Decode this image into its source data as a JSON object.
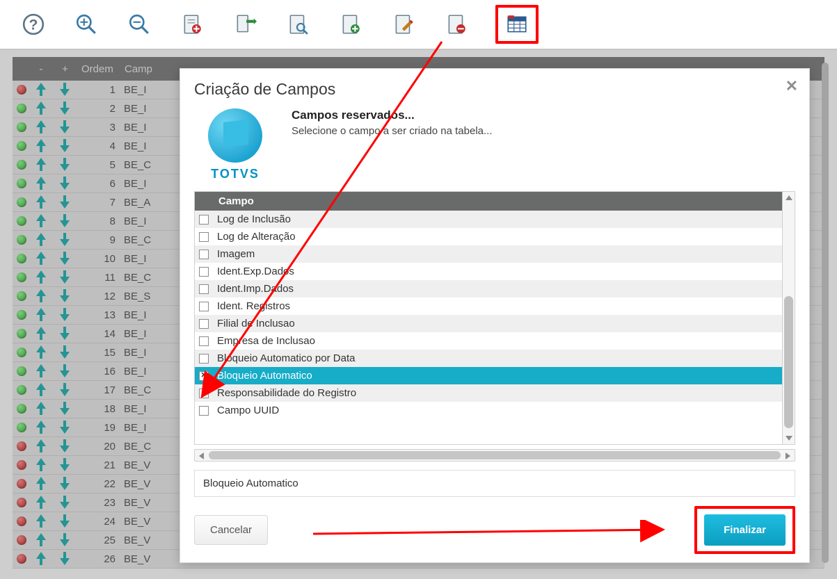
{
  "toolbar": {
    "icons": [
      "help",
      "zoom-in",
      "zoom-out",
      "doc-add",
      "doc-export",
      "doc-search",
      "doc-new",
      "doc-edit",
      "doc-delete",
      "table-grid"
    ]
  },
  "grid": {
    "head": {
      "minus": "-",
      "plus": "+",
      "ordem": "Ordem",
      "campo": "Camp"
    },
    "rows": [
      {
        "dot": "red",
        "ord": 1,
        "camp": "BE_I"
      },
      {
        "dot": "green",
        "ord": 2,
        "camp": "BE_I"
      },
      {
        "dot": "green",
        "ord": 3,
        "camp": "BE_I"
      },
      {
        "dot": "green",
        "ord": 4,
        "camp": "BE_I"
      },
      {
        "dot": "green",
        "ord": 5,
        "camp": "BE_C"
      },
      {
        "dot": "green",
        "ord": 6,
        "camp": "BE_I"
      },
      {
        "dot": "green",
        "ord": 7,
        "camp": "BE_A"
      },
      {
        "dot": "green",
        "ord": 8,
        "camp": "BE_I"
      },
      {
        "dot": "green",
        "ord": 9,
        "camp": "BE_C"
      },
      {
        "dot": "green",
        "ord": 10,
        "camp": "BE_I"
      },
      {
        "dot": "green",
        "ord": 11,
        "camp": "BE_C"
      },
      {
        "dot": "green",
        "ord": 12,
        "camp": "BE_S"
      },
      {
        "dot": "green",
        "ord": 13,
        "camp": "BE_I"
      },
      {
        "dot": "green",
        "ord": 14,
        "camp": "BE_I"
      },
      {
        "dot": "green",
        "ord": 15,
        "camp": "BE_I"
      },
      {
        "dot": "green",
        "ord": 16,
        "camp": "BE_I"
      },
      {
        "dot": "green",
        "ord": 17,
        "camp": "BE_C"
      },
      {
        "dot": "green",
        "ord": 18,
        "camp": "BE_I"
      },
      {
        "dot": "green",
        "ord": 19,
        "camp": "BE_I"
      },
      {
        "dot": "red",
        "ord": 20,
        "camp": "BE_C"
      },
      {
        "dot": "red",
        "ord": 21,
        "camp": "BE_V"
      },
      {
        "dot": "red",
        "ord": 22,
        "camp": "BE_V"
      },
      {
        "dot": "red",
        "ord": 23,
        "camp": "BE_V"
      },
      {
        "dot": "red",
        "ord": 24,
        "camp": "BE_V"
      },
      {
        "dot": "red",
        "ord": 25,
        "camp": "BE_V"
      },
      {
        "dot": "red",
        "ord": 26,
        "camp": "BE_V"
      }
    ]
  },
  "modal": {
    "title": "Criação de Campos",
    "logo_text": "TOTVS",
    "subtitle": "Campos reservados...",
    "subtext": "Selecione o campo a ser criado na tabela...",
    "list_header": "Campo",
    "fields": [
      {
        "label": "Log de Inclusão",
        "checked": false,
        "selected": false
      },
      {
        "label": "Log de Alteração",
        "checked": false,
        "selected": false
      },
      {
        "label": "Imagem",
        "checked": false,
        "selected": false
      },
      {
        "label": "Ident.Exp.Dados",
        "checked": false,
        "selected": false
      },
      {
        "label": "Ident.Imp.Dados",
        "checked": false,
        "selected": false
      },
      {
        "label": "Ident. Registros",
        "checked": false,
        "selected": false
      },
      {
        "label": "Filial de Inclusao",
        "checked": false,
        "selected": false
      },
      {
        "label": "Empresa de Inclusao",
        "checked": false,
        "selected": false
      },
      {
        "label": "Bloqueio Automatico por Data",
        "checked": false,
        "selected": false
      },
      {
        "label": "Bloqueio Automatico",
        "checked": true,
        "selected": true
      },
      {
        "label": "Responsabilidade do Registro",
        "checked": false,
        "selected": false
      },
      {
        "label": "Campo UUID",
        "checked": false,
        "selected": false
      }
    ],
    "selected_value": "Bloqueio Automatico",
    "cancel": "Cancelar",
    "finalize": "Finalizar"
  }
}
